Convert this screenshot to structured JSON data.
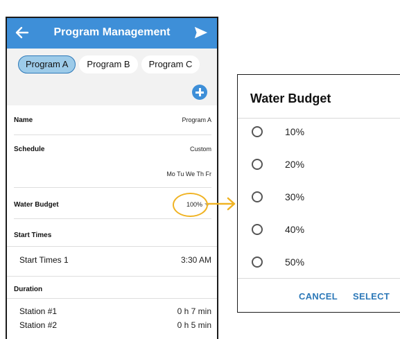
{
  "appbar": {
    "title": "Program Management",
    "back_icon": "arrow-left-icon",
    "send_icon": "send-icon",
    "color": "#3e8fd8"
  },
  "tabs": [
    {
      "label": "Program A",
      "active": true
    },
    {
      "label": "Program B",
      "active": false
    },
    {
      "label": "Program C",
      "active": false
    }
  ],
  "add_icon": "plus-circle-icon",
  "fields": {
    "name": {
      "label": "Name",
      "value": "Program A"
    },
    "schedule": {
      "label": "Schedule",
      "value": "Custom",
      "days": "Mo Tu We Th Fr"
    },
    "water_budget": {
      "label": "Water Budget",
      "value": "100%"
    },
    "start_times": {
      "header": "Start Times",
      "items": [
        {
          "label": "Start Times 1",
          "value": "3:30 AM"
        }
      ]
    },
    "duration": {
      "header": "Duration",
      "items": [
        {
          "label": "Station #1",
          "value": "0 h 7 min"
        },
        {
          "label": "Station #2",
          "value": "0 h 5 min"
        }
      ]
    }
  },
  "annotation": {
    "color": "#f0b323"
  },
  "dialog": {
    "title": "Water Budget",
    "options": [
      "10%",
      "20%",
      "30%",
      "40%",
      "50%"
    ],
    "cancel_label": "CANCEL",
    "select_label": "SELECT",
    "button_color": "#2c78b8"
  }
}
